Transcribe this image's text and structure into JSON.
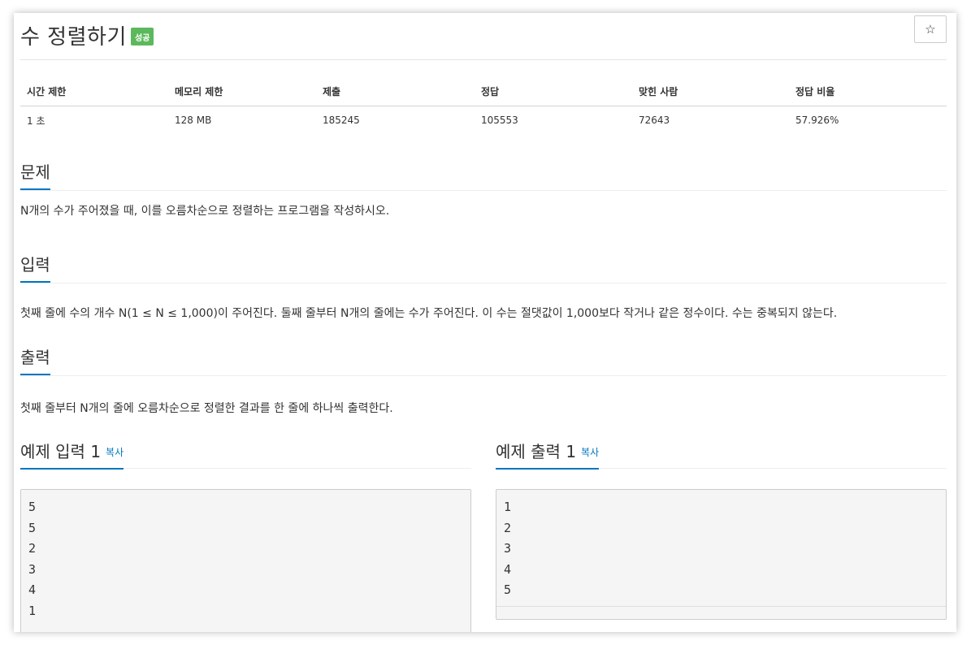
{
  "problem": {
    "title": "수 정렬하기",
    "badge": "성공",
    "star_icon_glyph": "☆"
  },
  "info_table": {
    "headers": [
      "시간 제한",
      "메모리 제한",
      "제출",
      "정답",
      "맞힌 사람",
      "정답 비율"
    ],
    "values": [
      "1 초",
      "128 MB",
      "185245",
      "105553",
      "72643",
      "57.926%"
    ]
  },
  "sections": {
    "description": {
      "heading": "문제",
      "text": "N개의 수가 주어졌을 때, 이를 오름차순으로 정렬하는 프로그램을 작성하시오."
    },
    "input": {
      "heading": "입력",
      "text": "첫째 줄에 수의 개수 N(1 ≤ N ≤ 1,000)이 주어진다. 둘째 줄부터 N개의 줄에는 수가 주어진다. 이 수는 절댓값이 1,000보다 작거나 같은 정수이다. 수는 중복되지 않는다."
    },
    "output": {
      "heading": "출력",
      "text": "첫째 줄부터 N개의 줄에 오름차순으로 정렬한 결과를 한 줄에 하나씩 출력한다."
    }
  },
  "samples": {
    "input": {
      "heading": "예제 입력 1",
      "copy_label": "복사",
      "content": "5\n5\n2\n3\n4\n1"
    },
    "output": {
      "heading": "예제 출력 1",
      "copy_label": "복사",
      "content": "1\n2\n3\n4\n5"
    }
  },
  "colors": {
    "accent": "#0076c0",
    "badge_success": "#5cb85c",
    "sample_background": "#f5f5f5"
  }
}
